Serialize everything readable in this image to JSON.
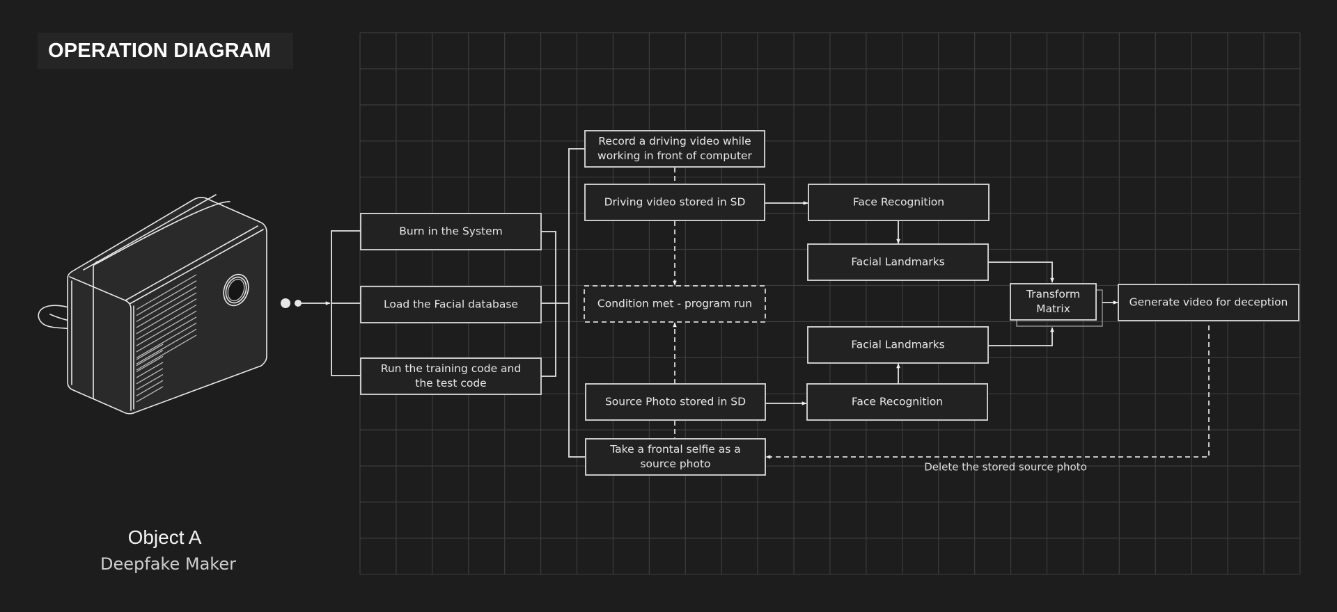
{
  "header": {
    "title": "OPERATION DIAGRAM"
  },
  "object": {
    "name": "Object A",
    "subtitle": "Deepfake Maker"
  },
  "device": {
    "icon": "camera-device-icon"
  },
  "nodes": {
    "burn_in": {
      "label": [
        "Burn in the System"
      ]
    },
    "load_db": {
      "label": [
        "Load the Facial database"
      ]
    },
    "run_code": {
      "label": [
        "Run the training code and",
        "the test code"
      ]
    },
    "record_video": {
      "label": [
        "Record a driving video while",
        "working in front of computer"
      ]
    },
    "video_stored": {
      "label": [
        "Driving video stored in SD"
      ]
    },
    "condition": {
      "label": [
        "Condition met - program run"
      ],
      "style": "dashed"
    },
    "photo_stored": {
      "label": [
        "Source Photo stored in SD"
      ]
    },
    "take_selfie": {
      "label": [
        "Take a frontal selfie as a",
        "source photo"
      ]
    },
    "face_rec_top": {
      "label": [
        "Face Recognition"
      ]
    },
    "landmarks_top": {
      "label": [
        "Facial Landmarks"
      ]
    },
    "landmarks_bottom": {
      "label": [
        "Facial Landmarks"
      ]
    },
    "face_rec_bottom": {
      "label": [
        "Face Recognition"
      ]
    },
    "transform": {
      "label": [
        "Transform",
        "Matrix"
      ]
    },
    "generate": {
      "label": [
        "Generate video for deception"
      ]
    }
  },
  "edges": {
    "delete_label": "Delete the stored source photo"
  },
  "colors": {
    "background": "#1d1d1e",
    "stroke": "#e6e6e6",
    "grid": "#3d3d3e"
  }
}
